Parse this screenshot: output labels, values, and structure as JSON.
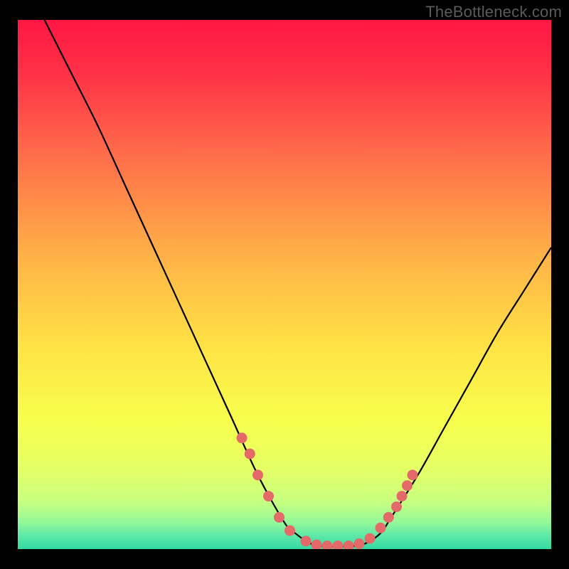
{
  "watermark": "TheBottleneck.com",
  "chart_data": {
    "type": "line",
    "title": "",
    "xlabel": "",
    "ylabel": "",
    "xlim": [
      0,
      100
    ],
    "ylim": [
      0,
      100
    ],
    "curve": {
      "x": [
        5,
        10,
        15,
        20,
        25,
        30,
        35,
        40,
        45,
        50,
        52,
        55,
        58,
        60,
        62,
        65,
        68,
        70,
        75,
        80,
        85,
        90,
        95,
        100
      ],
      "y": [
        100,
        90,
        80,
        69,
        58,
        47,
        36,
        25,
        14,
        5,
        3,
        1,
        0.5,
        0.5,
        0.5,
        1,
        3,
        6,
        14,
        23,
        32,
        41,
        49,
        57
      ]
    },
    "points": {
      "x": [
        42,
        43.5,
        45,
        47,
        49,
        51,
        54,
        56,
        58,
        60,
        62,
        64,
        66,
        68,
        69.5,
        71,
        72,
        73,
        74
      ],
      "y": [
        21,
        18,
        14,
        10,
        6,
        3.5,
        1.5,
        0.8,
        0.6,
        0.6,
        0.6,
        1,
        2,
        4,
        6,
        8,
        10,
        12,
        14
      ]
    },
    "gradient_stops": [
      {
        "offset": 0,
        "color": "#ff1744"
      },
      {
        "offset": 0.1,
        "color": "#ff3147"
      },
      {
        "offset": 0.25,
        "color": "#ff6b4a"
      },
      {
        "offset": 0.45,
        "color": "#ffb347"
      },
      {
        "offset": 0.62,
        "color": "#ffe345"
      },
      {
        "offset": 0.76,
        "color": "#f7ff4d"
      },
      {
        "offset": 0.85,
        "color": "#e4ff66"
      },
      {
        "offset": 0.91,
        "color": "#c8ff80"
      },
      {
        "offset": 0.95,
        "color": "#93f79a"
      },
      {
        "offset": 0.975,
        "color": "#5de8a7"
      },
      {
        "offset": 1.0,
        "color": "#33d9a6"
      }
    ],
    "point_color": "#e46a6a",
    "curve_color": "#000000"
  }
}
